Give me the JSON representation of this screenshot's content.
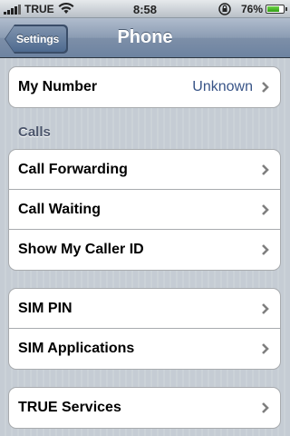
{
  "status_bar": {
    "carrier": "TRUE",
    "time": "8:58",
    "battery_percent": "76%",
    "battery_level": 0.76
  },
  "navbar": {
    "back_label": "Settings",
    "title": "Phone"
  },
  "groups": {
    "my_number": {
      "label": "My Number",
      "value": "Unknown"
    },
    "calls_header": "Calls",
    "call_forwarding": "Call Forwarding",
    "call_waiting": "Call Waiting",
    "show_caller_id": "Show My Caller ID",
    "sim_pin": "SIM PIN",
    "sim_applications": "SIM Applications",
    "true_services": "TRUE Services"
  },
  "icons": {
    "signal": "signal-bars-icon",
    "wifi": "wifi-icon",
    "lock": "orientation-lock-icon",
    "battery": "battery-icon",
    "chevron": "chevron-right-icon"
  },
  "colors": {
    "navbar": "#6d83a1",
    "value_text": "#385487",
    "section_header": "#4c566c"
  }
}
